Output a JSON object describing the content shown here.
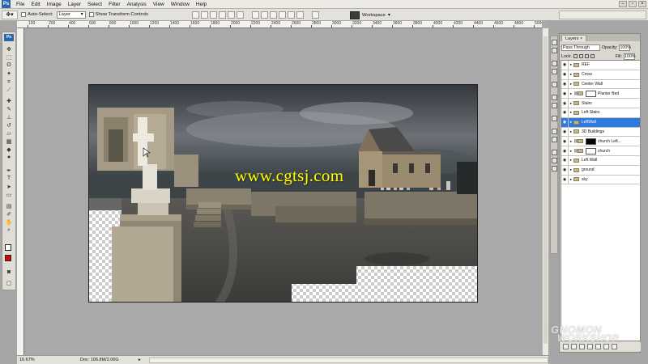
{
  "menu": [
    "File",
    "Edit",
    "Image",
    "Layer",
    "Select",
    "Filter",
    "Analysis",
    "View",
    "Window",
    "Help"
  ],
  "options": {
    "auto_select_label": "Auto-Select:",
    "auto_select_value": "Layer",
    "transform_controls_label": "Show Transform Controls",
    "workspace_label": "Workspace"
  },
  "toolbox": {
    "badge": "Ps",
    "foreground_color": "#ffffff",
    "background_color": "#e00000"
  },
  "ruler_labels": [
    "100",
    "200",
    "400",
    "600",
    "800",
    "1000",
    "1200",
    "1400",
    "1600",
    "1800",
    "2000",
    "2200",
    "2400",
    "2600",
    "2800",
    "3000",
    "3200",
    "3400",
    "3600",
    "3800",
    "4000",
    "4200",
    "4400",
    "4600",
    "4800",
    "5000"
  ],
  "canvas": {
    "watermark": "www.cgtsj.com"
  },
  "status": {
    "zoom": "16.67%",
    "doc": "Doc: 106.8M/2.06G"
  },
  "layers": {
    "tab_label": "Layers",
    "close": "×",
    "blend_mode": "Pass Through",
    "opacity_label": "Opacity:",
    "opacity_value": "100%",
    "lock_label": "Lock:",
    "fill_label": "Fill:",
    "fill_value": "100%",
    "items": [
      {
        "name": "REF",
        "type": "folder",
        "selected": false
      },
      {
        "name": "Cross",
        "type": "folder",
        "selected": false
      },
      {
        "name": "Center Wall",
        "type": "folder",
        "selected": false
      },
      {
        "name": "Planter Bed",
        "type": "folder-mask-white",
        "selected": false
      },
      {
        "name": "Stairs",
        "type": "folder",
        "selected": false
      },
      {
        "name": "Left Stairs",
        "type": "folder",
        "selected": false
      },
      {
        "name": "LeftWall",
        "type": "folder",
        "selected": true
      },
      {
        "name": "3D Buildings",
        "type": "folder",
        "selected": false
      },
      {
        "name": "church Left...",
        "type": "folder-mask-black",
        "selected": false
      },
      {
        "name": "church",
        "type": "folder-mask-white",
        "selected": false
      },
      {
        "name": "Left Wall",
        "type": "folder",
        "selected": false
      },
      {
        "name": "ground",
        "type": "folder",
        "selected": false
      },
      {
        "name": "sky",
        "type": "folder",
        "selected": false
      }
    ]
  },
  "brand": {
    "line1": "GNOMON",
    "line2": "WORKSHOP"
  }
}
